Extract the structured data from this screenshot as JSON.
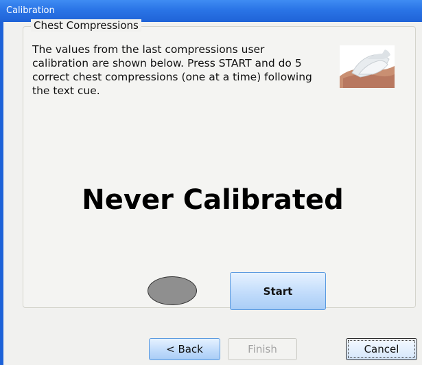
{
  "window": {
    "title": "Calibration"
  },
  "group": {
    "title": "Chest Compressions",
    "instructions": "The values from the last compressions user calibration are shown below.  Press START and do 5 correct chest compressions (one at a time) following the text cue."
  },
  "status": {
    "text": "Never Calibrated",
    "indicator_color": "#8f8f8f"
  },
  "buttons": {
    "start": "Start",
    "back": "< Back",
    "finish": "Finish",
    "cancel": "Cancel"
  },
  "icons": {
    "photo": "cpr-hands-photo",
    "indicator": "status-indicator-oval"
  }
}
